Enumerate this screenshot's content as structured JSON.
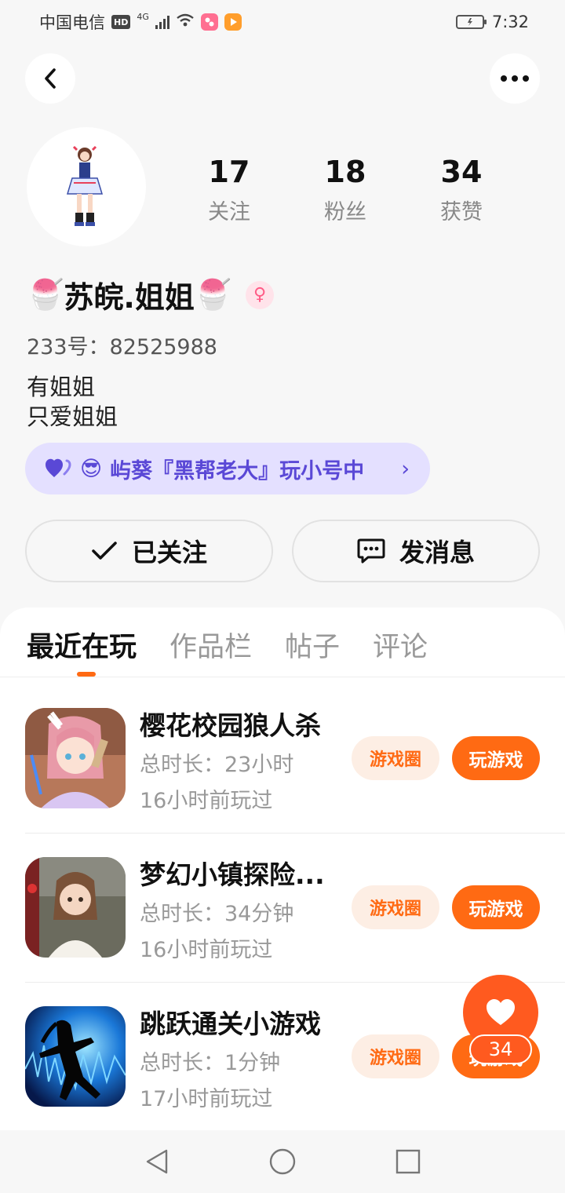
{
  "status_bar": {
    "carrier": "中国电信",
    "hd": "HD",
    "network": "4G",
    "time": "7:32"
  },
  "profile": {
    "stats": [
      {
        "value": "17",
        "label": "关注"
      },
      {
        "value": "18",
        "label": "粉丝"
      },
      {
        "value": "34",
        "label": "获赞"
      }
    ],
    "name_emoji_left": "🍧",
    "nickname": "苏皖.姐姐",
    "name_emoji_right": "🍧",
    "gender_symbol": "♀",
    "uid": "233号：82525988",
    "bio_line1": "有姐姐",
    "bio_line2": "只爱姐姐",
    "playing_chip": {
      "emoji": "😎",
      "text": "屿葵『黑帮老大』玩小号中",
      "chevron": "›"
    },
    "follow_button": "已关注",
    "message_button": "发消息"
  },
  "tabs": [
    {
      "label": "最近在玩",
      "active": true
    },
    {
      "label": "作品栏",
      "active": false
    },
    {
      "label": "帖子",
      "active": false
    },
    {
      "label": "评论",
      "active": false
    }
  ],
  "games": [
    {
      "title": "樱花校园狼人杀",
      "duration": "总时长：23小时",
      "last_played": "16小时前玩过",
      "circle_label": "游戏圈",
      "play_label": "玩游戏"
    },
    {
      "title": "梦幻小镇探险...",
      "duration": "总时长：34分钟",
      "last_played": "16小时前玩过",
      "circle_label": "游戏圈",
      "play_label": "玩游戏"
    },
    {
      "title": "跳跃通关小游戏",
      "duration": "总时长：1分钟",
      "last_played": "17小时前玩过",
      "circle_label": "游戏圈",
      "play_label": "玩游戏"
    }
  ],
  "like_fab": {
    "count": "34"
  },
  "colors": {
    "accent": "#ff6a13",
    "chip_bg": "#e4e0ff",
    "chip_text": "#5a48d6",
    "gender": "#ff5b86"
  },
  "icons": [
    "back-arrow-icon",
    "more-dots-icon",
    "check-icon",
    "chat-bubble-icon",
    "heart-icon",
    "nav-back-icon",
    "nav-home-icon",
    "nav-recent-icon"
  ]
}
